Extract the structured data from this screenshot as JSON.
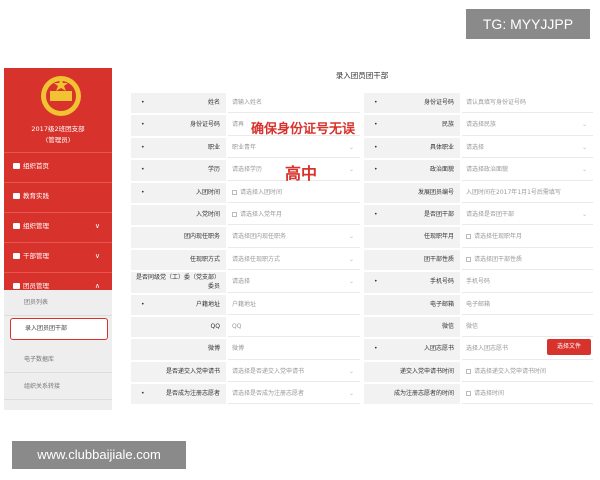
{
  "watermarks": {
    "tg": "TG: MYYJJPP",
    "url": "www.clubbaijiale.com"
  },
  "sidebar": {
    "org_line1": "2017级2班团支部",
    "org_line2": "(管理员)",
    "items": [
      {
        "label": "组织首页",
        "icon": "home-icon",
        "chevron": ""
      },
      {
        "label": "教育实践",
        "icon": "book-icon",
        "chevron": ""
      },
      {
        "label": "组织管理",
        "icon": "chart-icon",
        "chevron": "∨"
      },
      {
        "label": "干部管理",
        "icon": "people-icon",
        "chevron": "∨"
      },
      {
        "label": "团员管理",
        "icon": "person-icon",
        "chevron": "∧"
      }
    ],
    "sub_items": [
      "团员列表",
      "录入团员团干部",
      "电子数据库",
      "组织关系转接"
    ]
  },
  "form": {
    "title": "录入团员团干部",
    "rows": [
      {
        "l_req": "•",
        "l": "姓名",
        "lv": "请输入姓名",
        "r_req": "•",
        "r": "身份证号码",
        "rv": "请认真填写身份证号码"
      },
      {
        "l_req": "•",
        "l": "身份证号码",
        "lv": "请再",
        "r_req": "•",
        "r": "民族",
        "rv": "请选择民族"
      },
      {
        "l_req": "•",
        "l": "职业",
        "lv": "职业青年",
        "r_req": "•",
        "r": "具体职业",
        "rv": "请选择"
      },
      {
        "l_req": "•",
        "l": "学历",
        "lv": "请选择学历",
        "r_req": "•",
        "r": "政治面貌",
        "rv": "请选择政治面貌"
      },
      {
        "l_req": "•",
        "l": "入团时间",
        "lv": "请选择入团时间",
        "r_req": "",
        "r": "发展团员编号",
        "rv": "入团时间在2017年1月1号后需填写"
      },
      {
        "l_req": "",
        "l": "入党时间",
        "lv": "请选择入党年月",
        "r_req": "•",
        "r": "是否团干部",
        "rv": "请选择是否团干部"
      },
      {
        "l_req": "",
        "l": "团内现任职务",
        "lv": "请选择团内现任职务",
        "r_req": "",
        "r": "任现职年月",
        "rv": "请选择任现职年月"
      },
      {
        "l_req": "",
        "l": "任现职方式",
        "lv": "请选择任现职方式",
        "r_req": "",
        "r": "团干部性质",
        "rv": "请选择团干部性质"
      },
      {
        "l_req": "",
        "l": "是否同级党（工）委（党支部）委员",
        "lv": "请选择",
        "r_req": "•",
        "r": "手机号码",
        "rv": "手机号码"
      },
      {
        "l_req": "•",
        "l": "户籍地址",
        "lv": "户籍地址",
        "r_req": "",
        "r": "电子邮箱",
        "rv": "电子邮箱"
      },
      {
        "l_req": "",
        "l": "QQ",
        "lv": "QQ",
        "r_req": "",
        "r": "微信",
        "rv": "微信"
      },
      {
        "l_req": "",
        "l": "微博",
        "lv": "微博",
        "r_req": "•",
        "r": "入团志愿书",
        "rv": "选择入团志愿书"
      },
      {
        "l_req": "",
        "l": "是否递交入党申请书",
        "lv": "请选择是否递交入党申请书",
        "r_req": "",
        "r": "递交入党申请书时间",
        "rv": "请选择递交入党申请书时间"
      },
      {
        "l_req": "•",
        "l": "是否成为注册志愿者",
        "lv": "请选择是否成为注册志愿者",
        "r_req": "",
        "r": "成为注册志愿者的时间",
        "rv": "请选择时间"
      }
    ],
    "file_button": "选择文件",
    "note_id": "确保身份证号无误",
    "note_hs": "高中"
  },
  "colors": {
    "accent": "#d8322c",
    "label_bg": "#f2f2f2"
  }
}
